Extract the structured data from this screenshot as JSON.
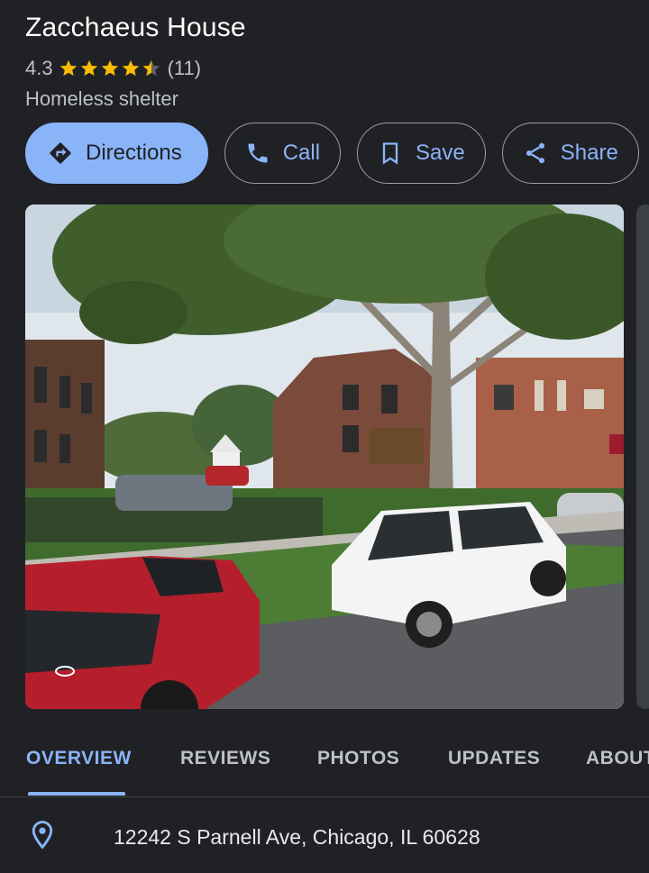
{
  "place": {
    "name": "Zacchaeus House",
    "rating": "4.3",
    "stars": 4.3,
    "review_count": "(11)",
    "category": "Homeless shelter"
  },
  "actions": {
    "directions": "Directions",
    "call": "Call",
    "save": "Save",
    "share": "Share"
  },
  "tabs": [
    "OVERVIEW",
    "REVIEWS",
    "PHOTOS",
    "UPDATES",
    "ABOUT"
  ],
  "active_tab": "OVERVIEW",
  "address": "12242 S Parnell Ave, Chicago, IL 60628",
  "colors": {
    "background": "#202124",
    "accent": "#8ab4f8",
    "star": "#fbbc04"
  },
  "icons": {
    "directions": "directions-icon",
    "call": "phone-icon",
    "save": "bookmark-icon",
    "share": "share-icon",
    "address": "location-pin-icon"
  }
}
